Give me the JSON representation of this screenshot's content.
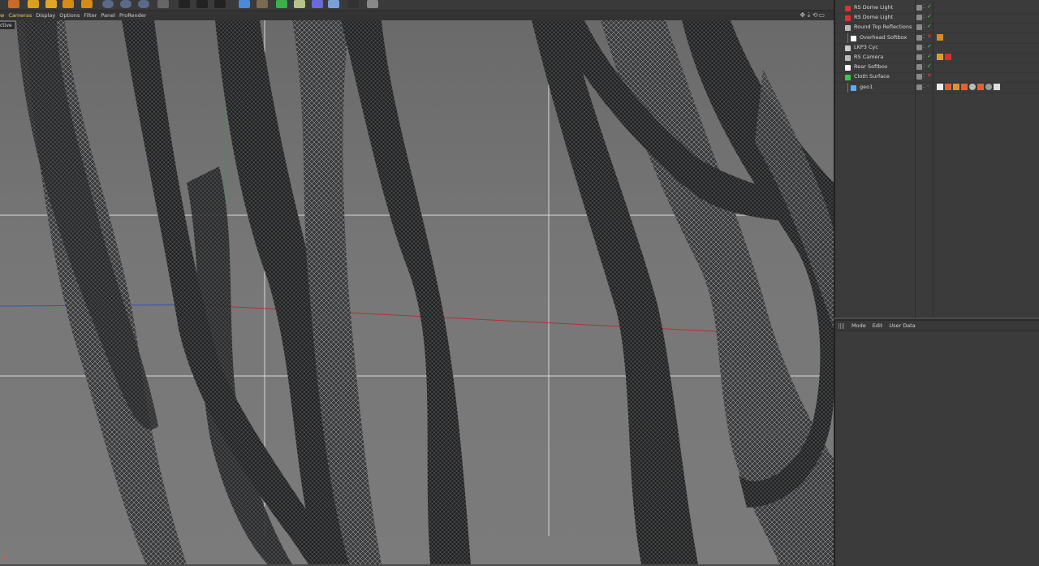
{
  "menu": {
    "items": [
      {
        "label": "w",
        "active": true
      },
      {
        "label": "Cameras",
        "active": true
      },
      {
        "label": "Display",
        "active": false
      },
      {
        "label": "Options",
        "active": false
      },
      {
        "label": "Filter",
        "active": false
      },
      {
        "label": "Panel",
        "active": false
      },
      {
        "label": "ProRender",
        "active": false
      }
    ]
  },
  "viewport": {
    "label": "ctive"
  },
  "objects": [
    {
      "name": "RS Dome Light",
      "indent": 0,
      "icon": "dome-light-icon",
      "color": "#e23030",
      "status": "check"
    },
    {
      "name": "RS Dome Light",
      "indent": 0,
      "icon": "dome-light-icon",
      "color": "#e23030",
      "status": "check"
    },
    {
      "name": "Round Top Reflections",
      "indent": 0,
      "icon": "null-group-icon",
      "color": "#bbbbbb",
      "status": "check"
    },
    {
      "name": "Overhead Softbox",
      "indent": 1,
      "icon": "area-light-icon",
      "color": "#ffffff",
      "status": "cross"
    },
    {
      "name": "LKP3 Cyc",
      "indent": 0,
      "icon": "cyc-icon",
      "color": "#cccccc",
      "status": "check"
    },
    {
      "name": "RS Camera",
      "indent": 0,
      "icon": "camera-icon",
      "color": "#bbbbbb",
      "status": "check"
    },
    {
      "name": "Rear Softbox",
      "indent": 0,
      "icon": "area-light-icon",
      "color": "#ffffff",
      "status": "check"
    },
    {
      "name": "Cloth Surface",
      "indent": 0,
      "icon": "cloth-icon",
      "color": "#3cc84a",
      "status": "cross"
    },
    {
      "name": "geo1",
      "indent": 1,
      "icon": "polygon-icon",
      "color": "#5ab0ff",
      "status": "dot"
    }
  ],
  "attributes": {
    "tabs": [
      {
        "label": "Mode"
      },
      {
        "label": "Edit"
      },
      {
        "label": "User Data"
      }
    ]
  },
  "colors": {
    "accent": "#e8c85a",
    "check": "#50d060",
    "cross": "#e04040"
  }
}
